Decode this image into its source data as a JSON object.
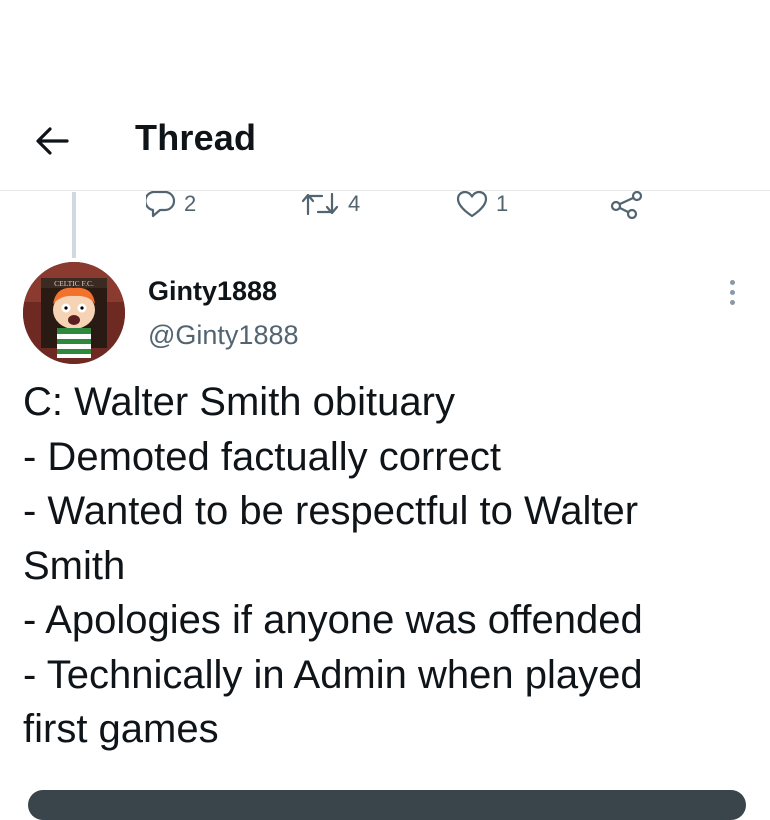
{
  "header": {
    "title": "Thread",
    "back_icon": "arrow-left-icon"
  },
  "prev_tweet_actions": {
    "reply_count": "2",
    "retweet_count": "4",
    "like_count": "1",
    "icons": [
      "reply-icon",
      "retweet-icon",
      "like-icon",
      "share-icon"
    ]
  },
  "tweet": {
    "display_name": "Ginty1888",
    "handle": "@Ginty1888",
    "avatar_text": "CELTIC F.C.",
    "lines": [
      "C: Walter Smith obituary",
      "- Demoted factually correct",
      "- Wanted to be respectful to Walter",
      "Smith",
      "- Apologies if anyone was offended",
      "- Technically in Admin when played",
      "first games"
    ]
  },
  "colors": {
    "text": "#0f1419",
    "secondary": "#536471",
    "divider": "#e6e9ec",
    "thread_line": "#cfd9de"
  }
}
